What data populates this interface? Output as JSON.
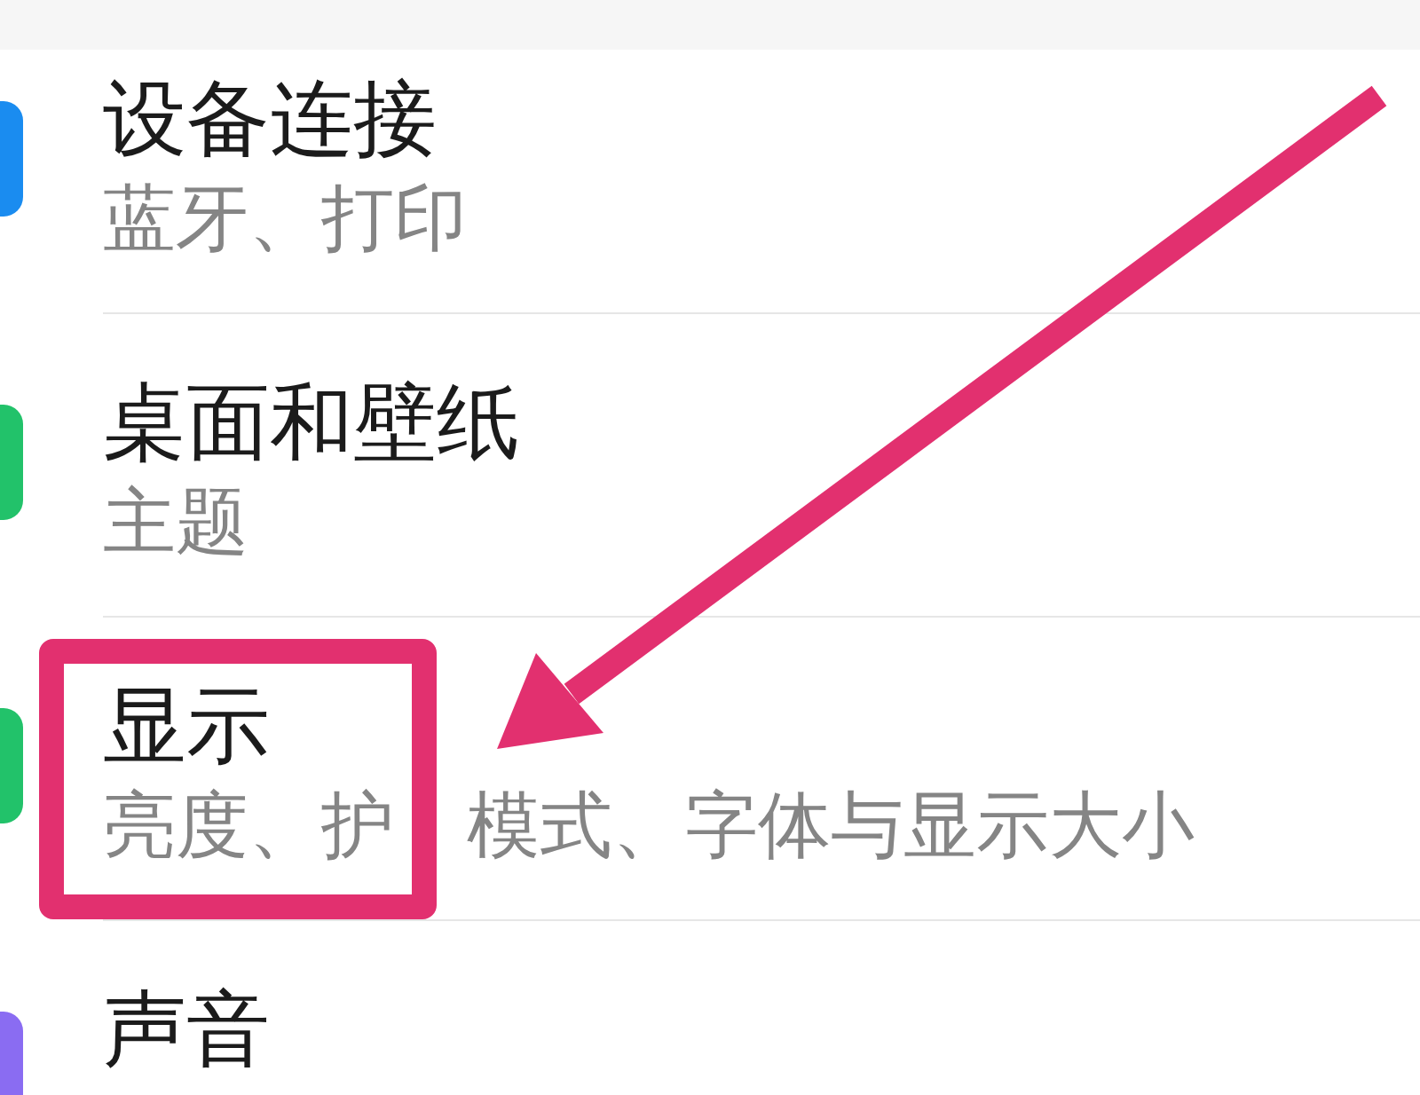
{
  "items": [
    {
      "title": "设备连接",
      "subtitle": [
        "蓝牙、打印"
      ],
      "color": "#1a8cf0",
      "highlighted": false
    },
    {
      "title": "桌面和壁纸",
      "subtitle": [
        "主题"
      ],
      "color": "#22c26a",
      "highlighted": false
    },
    {
      "title": "显示",
      "subtitle": [
        "亮度、护",
        "模式、字体与显示大小"
      ],
      "color": "#22c26a",
      "highlighted": true
    },
    {
      "title": "声音",
      "color": "#8a6cf2",
      "highlighted": false
    }
  ]
}
